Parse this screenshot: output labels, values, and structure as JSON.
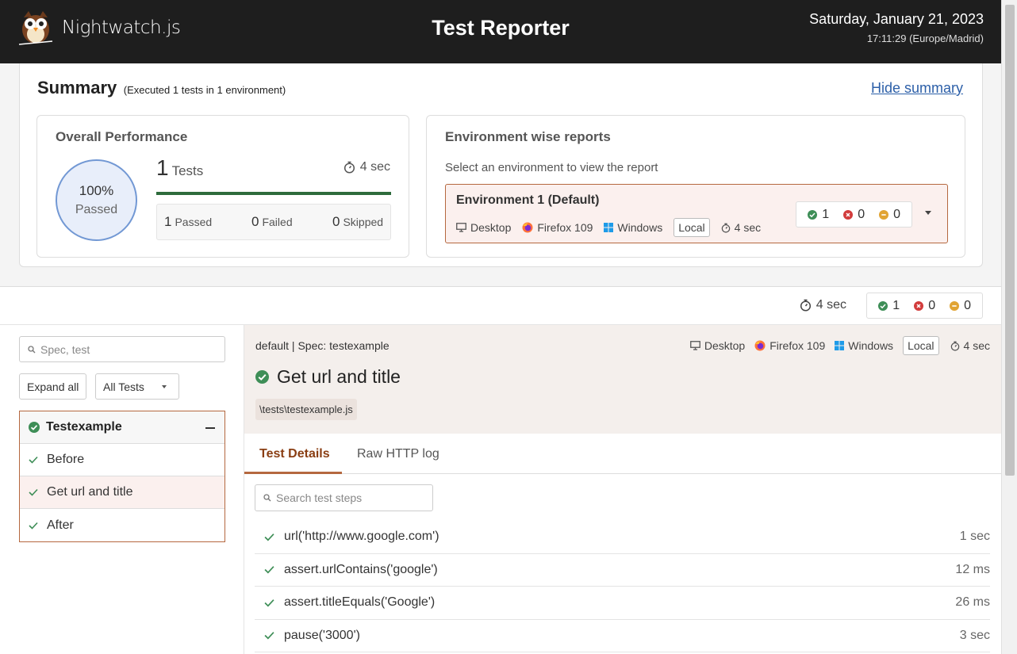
{
  "header": {
    "brand": "Nightwatch.js",
    "title": "Test Reporter",
    "date": "Saturday, January 21, 2023",
    "time": "17:11:29 (Europe/Madrid)"
  },
  "summary": {
    "title": "Summary",
    "subtitle": "(Executed 1 tests in 1 environment)",
    "hide_label": "Hide summary",
    "overall": {
      "title": "Overall Performance",
      "pass_percent": "100%",
      "pass_label": "Passed",
      "pass_fraction": 1.0,
      "tests_count": "1",
      "tests_label": "Tests",
      "duration": "4 sec",
      "passed_count": "1",
      "passed_label": "Passed",
      "failed_count": "0",
      "failed_label": "Failed",
      "skipped_count": "0",
      "skipped_label": "Skipped"
    },
    "env": {
      "title": "Environment wise reports",
      "hint": "Select an environment to view the report",
      "name": "Environment 1 (Default)",
      "device": "Desktop",
      "browser": "Firefox 109",
      "os": "Windows",
      "location": "Local",
      "duration": "4 sec",
      "passed": "1",
      "failed": "0",
      "skipped": "0"
    }
  },
  "stats": {
    "duration": "4 sec",
    "passed": "1",
    "failed": "0",
    "skipped": "0"
  },
  "sidebar": {
    "search_placeholder": "Spec, test",
    "expand_label": "Expand all",
    "filter_label": "All Tests",
    "suite": "Testexample",
    "items": [
      {
        "label": "Before"
      },
      {
        "label": "Get url and title"
      },
      {
        "label": "After"
      }
    ]
  },
  "detail": {
    "crumb": "default | Spec: testexample",
    "device": "Desktop",
    "browser": "Firefox 109",
    "os": "Windows",
    "location": "Local",
    "duration": "4 sec",
    "test_title": "Get url and title",
    "file": "\\tests\\testexample.js",
    "tabs": {
      "details": "Test Details",
      "http": "Raw HTTP log"
    },
    "step_search_placeholder": "Search test steps",
    "steps": [
      {
        "name": "url('http://www.google.com')",
        "time": "1 sec"
      },
      {
        "name": "assert.urlContains('google')",
        "time": "12 ms"
      },
      {
        "name": "assert.titleEquals('Google')",
        "time": "26 ms"
      },
      {
        "name": "pause('3000')",
        "time": "3 sec"
      }
    ]
  },
  "colors": {
    "pass": "#3e8e57",
    "fail": "#d23c3c",
    "skip": "#e1a433",
    "accent": "#b5683f"
  }
}
